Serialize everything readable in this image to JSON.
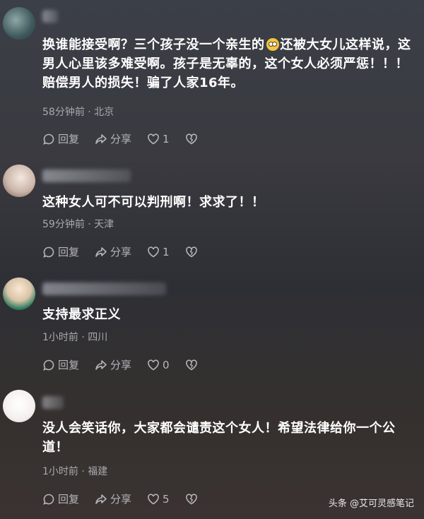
{
  "comments": [
    {
      "text_a": "换谁能接受啊？三个孩子没一个亲生的",
      "text_b": "还被大女儿这样说，这男人心里该多难受啊。孩子是无辜的，这个女人必须严惩！！！赔偿男人的损失！骗了人家16年。",
      "meta": "58分钟前 · 北京",
      "reply": "回复",
      "share": "分享",
      "likes": "1"
    },
    {
      "text": "这种女人可不可以判刑啊！求求了！！",
      "meta": "59分钟前 · 天津",
      "reply": "回复",
      "share": "分享",
      "likes": "1"
    },
    {
      "text": "支持最求正义",
      "meta": "1小时前 · 四川",
      "reply": "回复",
      "share": "分享",
      "likes": "0"
    },
    {
      "text": "没人会笑话你，大家都会谴责这个女人！希望法律给你一个公道！",
      "meta": "1小时前 · 福建",
      "reply": "回复",
      "share": "分享",
      "likes": "5"
    }
  ],
  "watermark": "头条 @艾可灵感笔记"
}
